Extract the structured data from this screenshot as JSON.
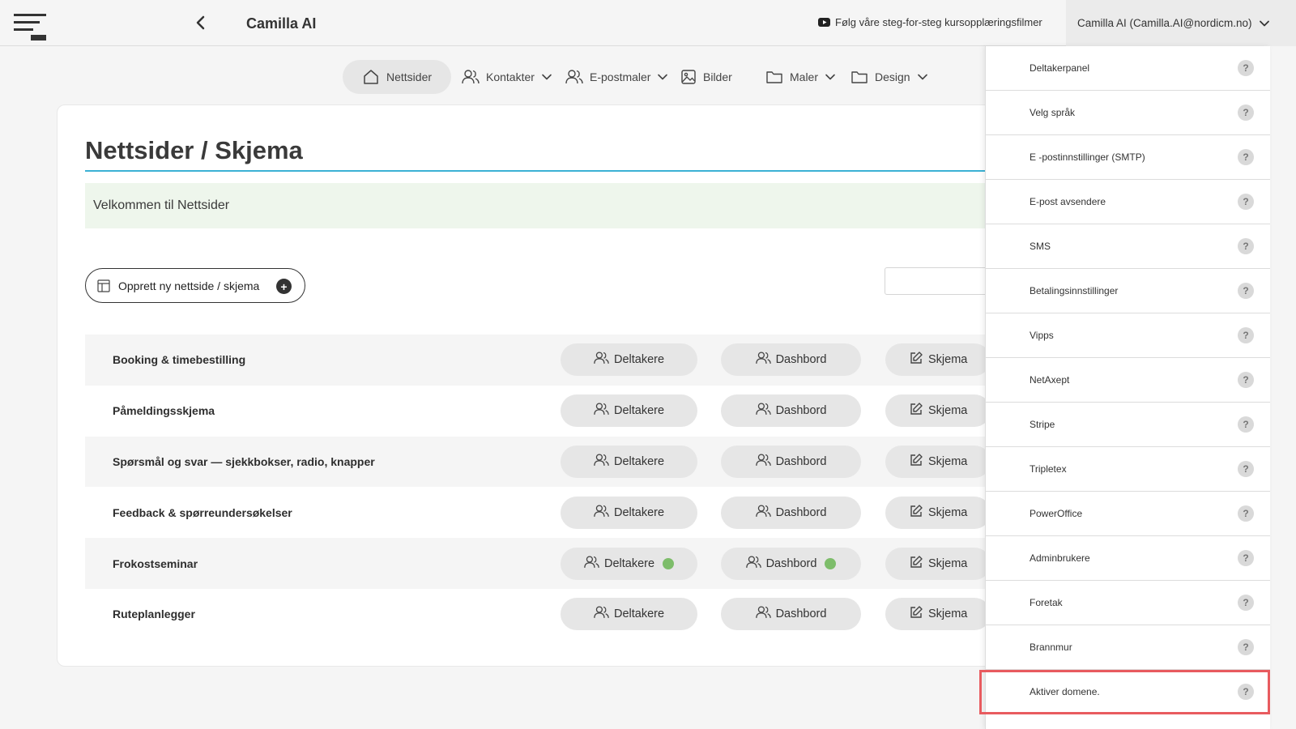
{
  "header": {
    "app_title": "Camilla AI",
    "tutorial_link": "Følg våre steg-for-steg kursopplæringsfilmer",
    "user_label": "Camilla AI (Camilla.AI@nordicm.no)"
  },
  "nav": {
    "items": [
      {
        "label": "Nettsider",
        "icon": "home-icon",
        "active": true
      },
      {
        "label": "Kontakter",
        "icon": "users-icon",
        "dropdown": true
      },
      {
        "label": "E-postmaler",
        "icon": "users-icon",
        "dropdown": true
      },
      {
        "label": "Bilder",
        "icon": "image-icon"
      },
      {
        "label": "Maler",
        "icon": "folder-icon",
        "dropdown": true
      },
      {
        "label": "Design",
        "icon": "folder-icon",
        "dropdown": true
      }
    ]
  },
  "main": {
    "title": "Nettsider / Skjema",
    "welcome": "Velkommen til Nettsider",
    "create_button": "Opprett ny nettside / skjema",
    "row_buttons": {
      "participants": "Deltakere",
      "dashboard": "Dashbord",
      "form": "Skjema"
    },
    "rows": [
      {
        "name": "Booking & timebestilling",
        "status_dot": false
      },
      {
        "name": "Påmeldingsskjema",
        "status_dot": false
      },
      {
        "name": "Spørsmål og svar — sjekkbokser, radio, knapper",
        "status_dot": false
      },
      {
        "name": "Feedback & spørreundersøkelser",
        "status_dot": false
      },
      {
        "name": "Frokostseminar",
        "status_dot": true
      },
      {
        "name": "Ruteplanlegger",
        "status_dot": false
      }
    ]
  },
  "settings_menu": {
    "help_glyph": "?",
    "items": [
      "Deltakerpanel",
      "Velg språk",
      "E -postinnstillinger (SMTP)",
      "E-post avsendere",
      "SMS",
      "Betalingsinnstillinger",
      "Vipps",
      "NetAxept",
      "Stripe",
      "Tripletex",
      "PowerOffice",
      "Adminbrukere",
      "Foretak",
      "Brannmur",
      "Aktiver domene."
    ],
    "highlighted_index": 14
  },
  "colors": {
    "accent_line": "#3bb1d4",
    "welcome_bg": "#eef6ec",
    "status_dot": "#7dbd6a",
    "highlight": "#e85b5f"
  }
}
